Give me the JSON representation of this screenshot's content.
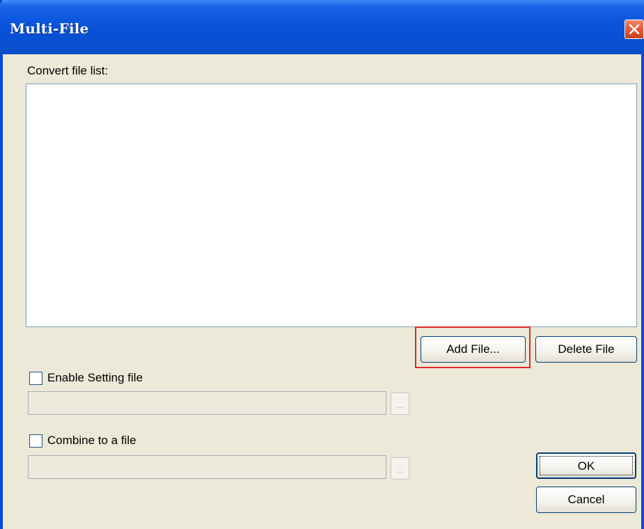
{
  "window": {
    "title": "Multi-File",
    "close_icon": "close-icon"
  },
  "file_list": {
    "label": "Convert file list:",
    "items": []
  },
  "buttons": {
    "add_file": "Add File...",
    "delete_file": "Delete File",
    "ok": "OK",
    "cancel": "Cancel"
  },
  "enable_setting": {
    "label": "Enable Setting file",
    "checked": false,
    "path_value": "",
    "browse_label": "..."
  },
  "combine": {
    "label": "Combine to a file",
    "checked": false,
    "path_value": "",
    "browse_label": "..."
  },
  "colors": {
    "titlebar": "#0a55dc",
    "face": "#ece9d8",
    "highlight": "#e0272c",
    "close": "#e35a35"
  }
}
